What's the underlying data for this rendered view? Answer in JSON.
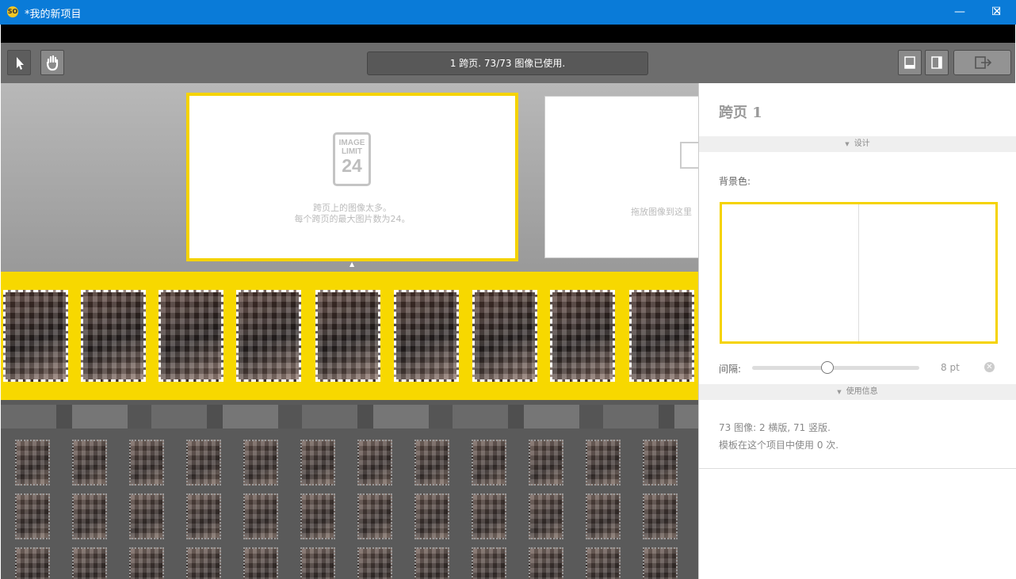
{
  "window": {
    "title": "*我的新项目",
    "minimize": "—",
    "maximize": "☐",
    "close": "✕"
  },
  "toolbar": {
    "status": "1 跨页. 73/73 图像已使用.",
    "tools": [
      "select-tool",
      "hand-tool"
    ],
    "view_buttons": [
      "bottom-panel-toggle",
      "side-panel-toggle",
      "export"
    ]
  },
  "spread_canvas": {
    "limit_badge": {
      "word1": "IMAGE",
      "word2": "LIMIT",
      "number": "24"
    },
    "warning_line1": "跨页上的图像太多。",
    "warning_line2": "每个跨页的最大图片数为24。",
    "drop_hint": "拖放图像到这里"
  },
  "panel": {
    "title": "跨页 1",
    "design_section": "设计",
    "background_label": "背景色:",
    "gap_label": "间隔:",
    "gap_value": "8 pt",
    "gap_level": 0.45,
    "usage_section": "使用信息",
    "usage_line1": "73 图像: 2 横版, 71 竖版.",
    "usage_line2": "模板在这个项目中使用 0 次."
  },
  "colors": {
    "accent": "#f5d300",
    "titlebar": "#0a7bd8"
  }
}
